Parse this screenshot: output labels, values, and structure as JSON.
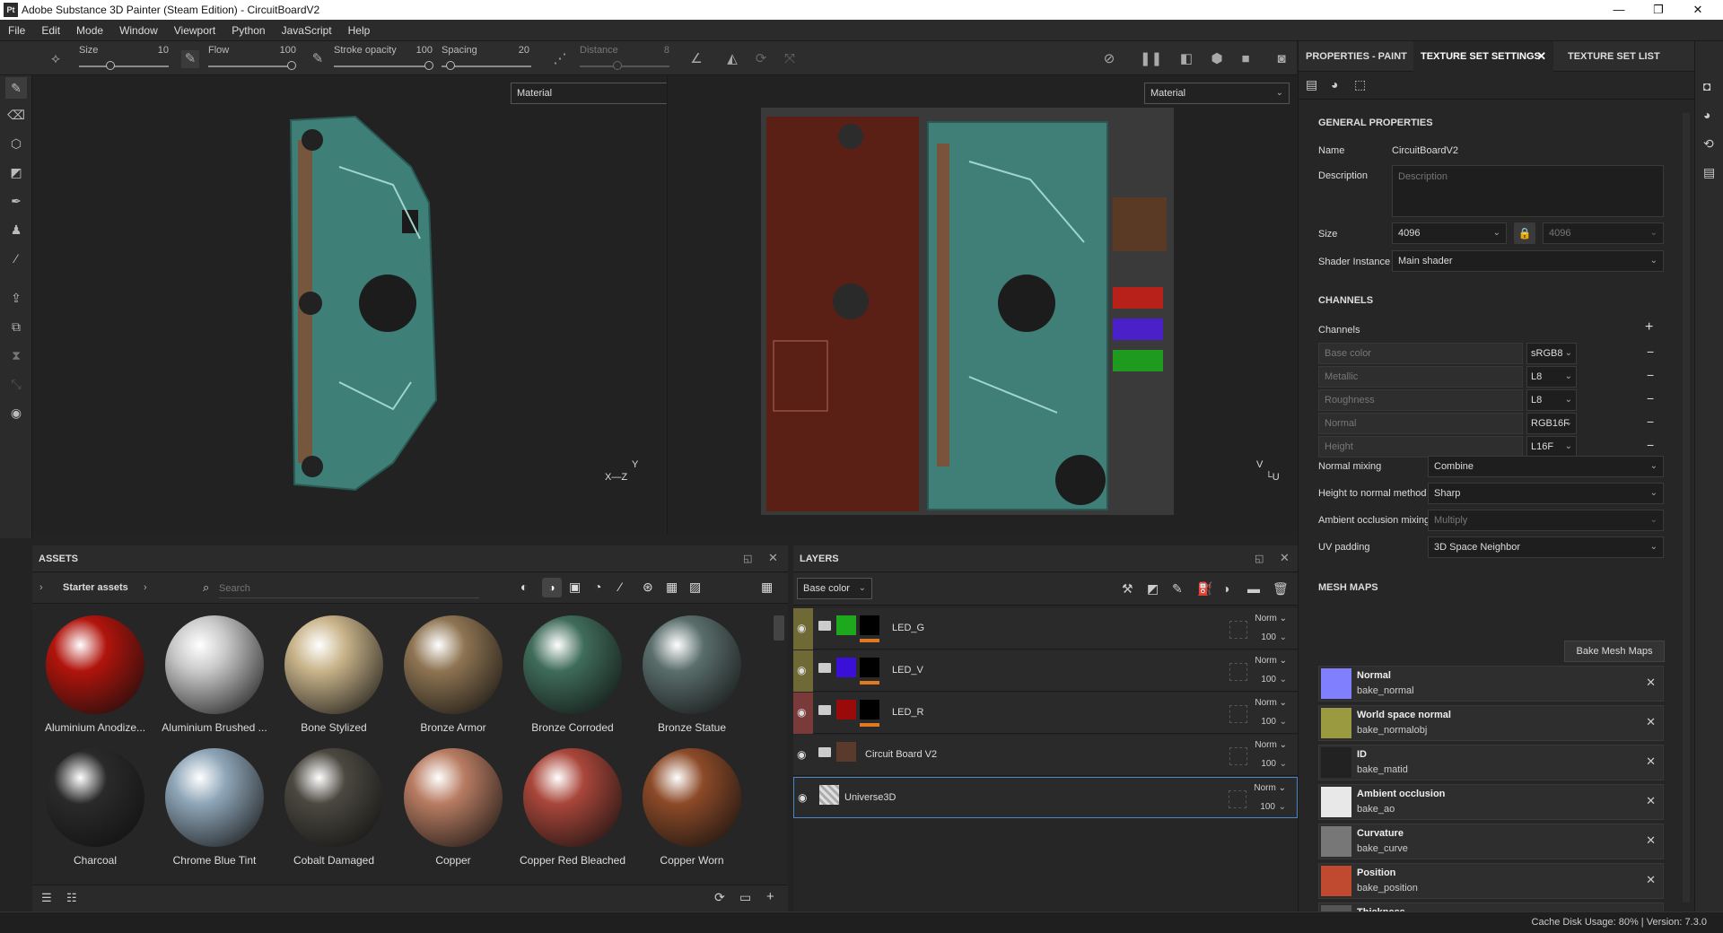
{
  "window": {
    "title": "Adobe Substance 3D Painter (Steam Edition) - CircuitBoardV2",
    "app_icon": "Pt"
  },
  "menu": [
    "File",
    "Edit",
    "Mode",
    "Window",
    "Viewport",
    "Python",
    "JavaScript",
    "Help"
  ],
  "toolbar": {
    "size_label": "Size",
    "size_value": "10",
    "flow_label": "Flow",
    "flow_value": "100",
    "stroke_opacity_label": "Stroke opacity",
    "stroke_opacity_value": "100",
    "spacing_label": "Spacing",
    "spacing_value": "20",
    "distance_label": "Distance",
    "distance_value": "8"
  },
  "viewport": {
    "left_mode": "Material",
    "right_mode": "Material",
    "left_axes": {
      "x": "X",
      "y": "Y",
      "z": "Z"
    },
    "right_axes": {
      "u": "U",
      "v": "V"
    }
  },
  "assets": {
    "title": "ASSETS",
    "breadcrumb": "Starter assets",
    "search_placeholder": "Search",
    "items": [
      {
        "name": "Aluminium Anodize...",
        "color": "#b0140c"
      },
      {
        "name": "Aluminium Brushed ...",
        "color": "#c9c9c9"
      },
      {
        "name": "Bone Stylized",
        "color": "#c9b48a"
      },
      {
        "name": "Bronze Armor",
        "color": "#8e7452"
      },
      {
        "name": "Bronze Corroded",
        "color": "#3f6c5a"
      },
      {
        "name": "Bronze Statue",
        "color": "#5a6e6c"
      },
      {
        "name": "Charcoal",
        "color": "#2a2a2a"
      },
      {
        "name": "Chrome Blue Tint",
        "color": "#8fa6b8"
      },
      {
        "name": "Cobalt Damaged",
        "color": "#4b4840"
      },
      {
        "name": "Copper",
        "color": "#b87c62"
      },
      {
        "name": "Copper Red Bleached",
        "color": "#a9463a"
      },
      {
        "name": "Copper Worn",
        "color": "#8c4a28"
      }
    ]
  },
  "layers": {
    "title": "LAYERS",
    "channel": "Base color",
    "items": [
      {
        "name": "LED_G",
        "blend": "Norm",
        "opacity": "100",
        "band": "#6f6a35",
        "thumb": "#1ea81e",
        "selected": false
      },
      {
        "name": "LED_V",
        "blend": "Norm",
        "opacity": "100",
        "band": "#6f6a35",
        "thumb": "#3a10d8",
        "selected": false
      },
      {
        "name": "LED_R",
        "blend": "Norm",
        "opacity": "100",
        "band": "#7a3a3a",
        "thumb": "#9a0a0a",
        "selected": false
      },
      {
        "name": "Circuit Board V2",
        "blend": "Norm",
        "opacity": "100",
        "band": "",
        "thumb": "#5a3a2a",
        "selected": false
      },
      {
        "name": "Universe3D",
        "blend": "Norm",
        "opacity": "100",
        "band": "",
        "thumb": "#ddd",
        "selected": true
      }
    ]
  },
  "right_panel": {
    "tabs": [
      "PROPERTIES - PAINT",
      "TEXTURE SET SETTINGS",
      "TEXTURE SET LIST"
    ],
    "general": {
      "title": "GENERAL PROPERTIES",
      "name_label": "Name",
      "name_value": "CircuitBoardV2",
      "desc_label": "Description",
      "desc_placeholder": "Description",
      "size_label": "Size",
      "size_value": "4096",
      "size_value2": "4096",
      "shader_label": "Shader Instance",
      "shader_value": "Main shader"
    },
    "channels": {
      "title": "CHANNELS",
      "label": "Channels",
      "items": [
        {
          "name": "Base color",
          "format": "sRGB8"
        },
        {
          "name": "Metallic",
          "format": "L8"
        },
        {
          "name": "Roughness",
          "format": "L8"
        },
        {
          "name": "Normal",
          "format": "RGB16F"
        },
        {
          "name": "Height",
          "format": "L16F"
        }
      ],
      "normal_mixing_label": "Normal mixing",
      "normal_mixing_value": "Combine",
      "h2n_label": "Height to normal method",
      "h2n_value": "Sharp",
      "ao_mixing_label": "Ambient occlusion mixing",
      "ao_mixing_value": "Multiply",
      "uv_padding_label": "UV padding",
      "uv_padding_value": "3D Space Neighbor"
    },
    "mesh_maps": {
      "title": "MESH MAPS",
      "bake_button": "Bake Mesh Maps",
      "items": [
        {
          "name": "Normal",
          "sub": "bake_normal",
          "color": "#8080ff"
        },
        {
          "name": "World space normal",
          "sub": "bake_normalobj",
          "color": "#9a9a40"
        },
        {
          "name": "ID",
          "sub": "bake_matid",
          "color": "#222"
        },
        {
          "name": "Ambient occlusion",
          "sub": "bake_ao",
          "color": "#e8e8e8"
        },
        {
          "name": "Curvature",
          "sub": "bake_curve",
          "color": "#777"
        },
        {
          "name": "Position",
          "sub": "bake_position",
          "color": "#c04a30"
        },
        {
          "name": "Thickness",
          "sub": "",
          "color": "#555"
        }
      ]
    }
  },
  "status": {
    "text": "Cache Disk Usage:   80% | Version: 7.3.0"
  }
}
